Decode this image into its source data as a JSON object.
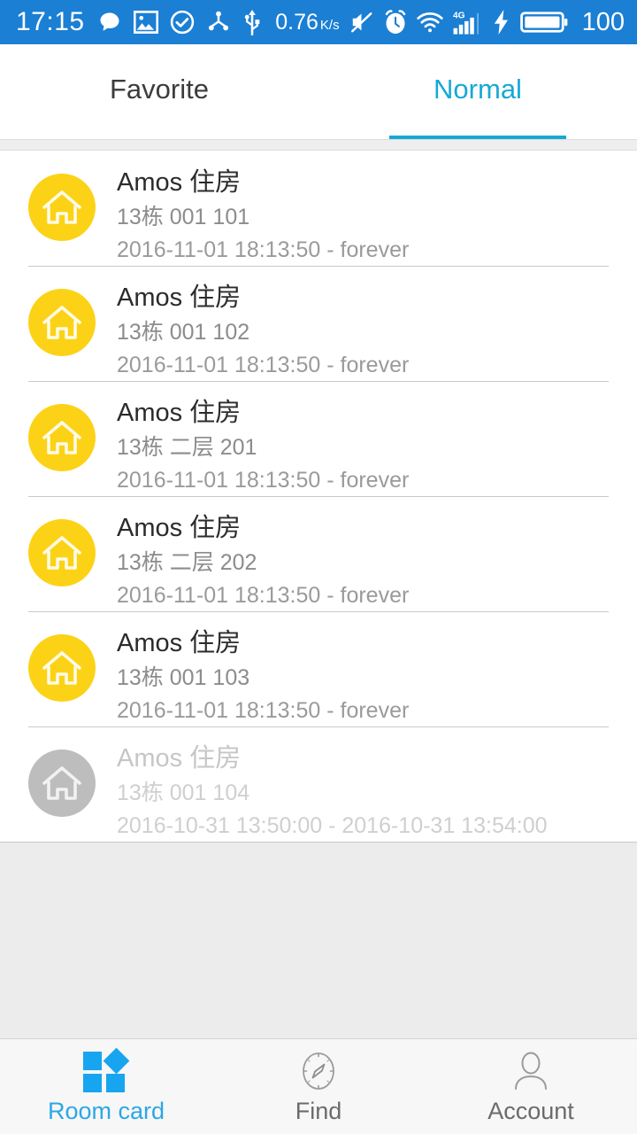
{
  "statusbar": {
    "time": "17:15",
    "left_icons": [
      "message-bubble-icon",
      "photo-icon",
      "check-circle-icon",
      "share-nodes-icon",
      "usb-icon"
    ],
    "network_speed": "0.76",
    "network_speed_unit": "K/s",
    "right_icons": [
      "mute-icon",
      "alarm-clock-icon",
      "wifi-icon",
      "signal-4g-icon",
      "charging-bolt-icon",
      "battery-icon"
    ],
    "battery_level": "100",
    "background_color": "#1b7fd4",
    "foreground_color": "#ffffff"
  },
  "tabs": {
    "accent_color": "#17a9d4",
    "items": [
      {
        "label": "Favorite",
        "active": false
      },
      {
        "label": "Normal",
        "active": true
      }
    ]
  },
  "list": {
    "avatar_color_active": "#fcd217",
    "avatar_color_disabled": "#bdbdbd",
    "rows": [
      {
        "icon": "house-icon",
        "title": "Amos 住房",
        "location": "13栋 001 101",
        "validity": "2016-11-01 18:13:50 - forever",
        "disabled": false
      },
      {
        "icon": "house-icon",
        "title": "Amos 住房",
        "location": "13栋 001 102",
        "validity": "2016-11-01 18:13:50 - forever",
        "disabled": false
      },
      {
        "icon": "house-icon",
        "title": "Amos 住房",
        "location": "13栋 二层 201",
        "validity": "2016-11-01 18:13:50 - forever",
        "disabled": false
      },
      {
        "icon": "house-icon",
        "title": "Amos 住房",
        "location": "13栋 二层 202",
        "validity": "2016-11-01 18:13:50 - forever",
        "disabled": false
      },
      {
        "icon": "house-icon",
        "title": "Amos 住房",
        "location": "13栋 001 103",
        "validity": "2016-11-01 18:13:50 - forever",
        "disabled": false
      },
      {
        "icon": "house-icon",
        "title": "Amos 住房",
        "location": "13栋 001 104",
        "validity": "2016-10-31 13:50:00 - 2016-10-31 13:54:00",
        "disabled": true
      }
    ]
  },
  "bottom_nav": {
    "active_color": "#2ca7e6",
    "inactive_color": "#6b6b6b",
    "items": [
      {
        "label": "Room card",
        "icon": "room-card-icon",
        "active": true
      },
      {
        "label": "Find",
        "icon": "compass-icon",
        "active": false
      },
      {
        "label": "Account",
        "icon": "person-icon",
        "active": false
      }
    ]
  }
}
